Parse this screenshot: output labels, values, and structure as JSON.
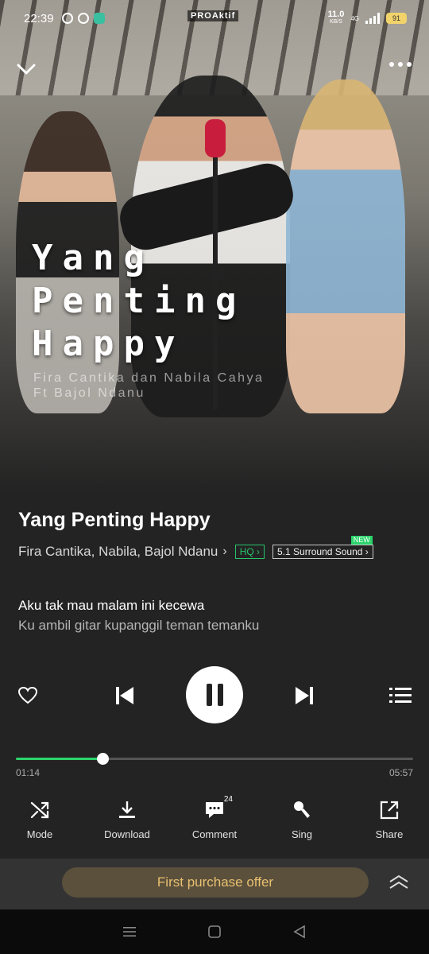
{
  "status_bar": {
    "time": "22:39",
    "center_badge": "PROAktif",
    "net_speed": "11.0",
    "net_unit": "KB/S",
    "network": "4G",
    "battery": "91"
  },
  "cover": {
    "title_lines": [
      "Yang",
      "Penting",
      "Happy"
    ],
    "artist_line1": "Fira Cantika dan Nabila Cahya",
    "artist_line2": "Ft Bajol Ndanu"
  },
  "song": {
    "title": "Yang Penting Happy",
    "artist": "Fira Cantika, Nabila, Bajol Ndanu",
    "quality_badge": "HQ",
    "surround_badge": "5.1 Surround Sound",
    "new_label": "NEW"
  },
  "lyrics": {
    "current": "Aku tak mau malam ini kecewa",
    "next": "Ku ambil gitar kupanggil teman temanku"
  },
  "progress": {
    "current": "01:14",
    "total": "05:57",
    "fraction": 0.217
  },
  "actions": [
    {
      "label": "Mode",
      "icon": "shuffle-icon"
    },
    {
      "label": "Download",
      "icon": "download-icon"
    },
    {
      "label": "Comment",
      "icon": "comment-icon",
      "count": "24"
    },
    {
      "label": "Sing",
      "icon": "microphone-icon"
    },
    {
      "label": "Share",
      "icon": "share-icon"
    }
  ],
  "offer": {
    "label": "First purchase offer"
  },
  "colors": {
    "accent": "#2bd36b",
    "background": "#232323",
    "offer_text": "#e8c070",
    "offer_bg": "#5a503c"
  }
}
